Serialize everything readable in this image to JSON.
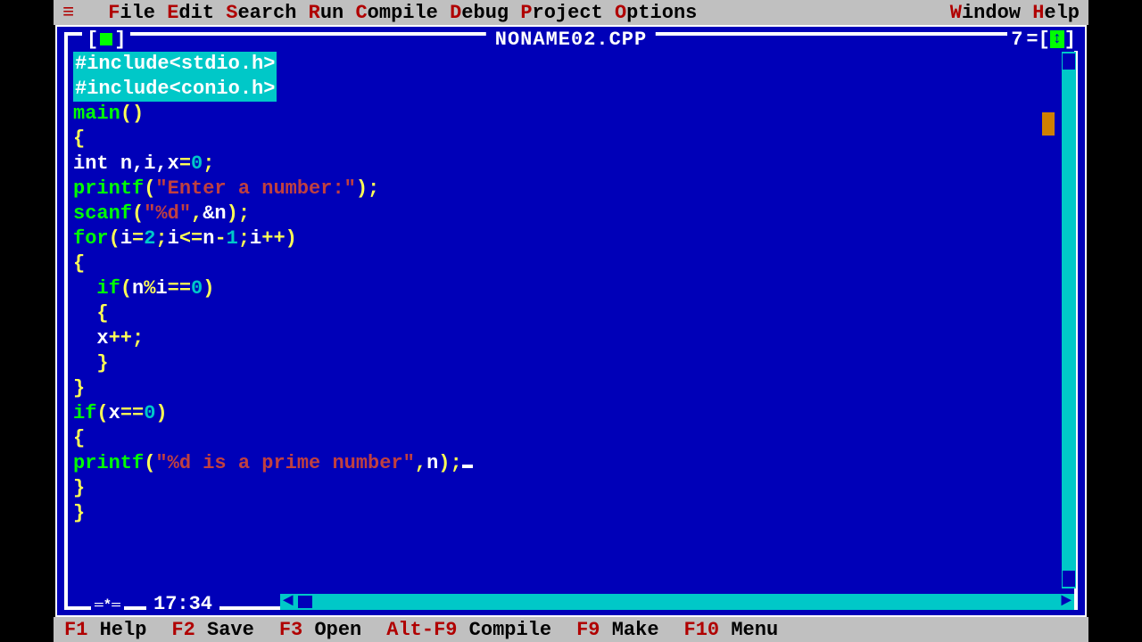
{
  "menu": {
    "icon": "≡",
    "items": [
      {
        "hotkey": "F",
        "rest": "ile"
      },
      {
        "hotkey": "E",
        "rest": "dit"
      },
      {
        "hotkey": "S",
        "rest": "earch"
      },
      {
        "hotkey": "R",
        "rest": "un"
      },
      {
        "hotkey": "C",
        "rest": "ompile"
      },
      {
        "hotkey": "D",
        "rest": "ebug"
      },
      {
        "hotkey": "P",
        "rest": "roject"
      },
      {
        "hotkey": "O",
        "rest": "ptions"
      }
    ],
    "rightItems": [
      {
        "hotkey": "W",
        "rest": "indow"
      },
      {
        "hotkey": "H",
        "rest": "elp"
      }
    ]
  },
  "window": {
    "title": "NONAME02.CPP",
    "windowNumber": "7",
    "cursorPos": "17:34"
  },
  "code": {
    "lines": [
      {
        "type": "include",
        "text": "#include<stdio.h>"
      },
      {
        "type": "include",
        "text": "#include<conio.h>"
      },
      {
        "seg": [
          {
            "c": "kw",
            "t": "main"
          },
          {
            "c": "punc",
            "t": "()"
          }
        ]
      },
      {
        "seg": [
          {
            "c": "punc",
            "t": "{"
          }
        ]
      },
      {
        "seg": [
          {
            "c": "ty",
            "t": "int "
          },
          {
            "c": "ty",
            "t": "n,i,x"
          },
          {
            "c": "punc",
            "t": "="
          },
          {
            "c": "num",
            "t": "0"
          },
          {
            "c": "punc",
            "t": ";"
          }
        ]
      },
      {
        "seg": [
          {
            "c": "kw",
            "t": "printf"
          },
          {
            "c": "punc",
            "t": "("
          },
          {
            "c": "str",
            "t": "\"Enter a number:\""
          },
          {
            "c": "punc",
            "t": ");"
          }
        ]
      },
      {
        "seg": [
          {
            "c": "kw",
            "t": "scanf"
          },
          {
            "c": "punc",
            "t": "("
          },
          {
            "c": "str",
            "t": "\"%d\""
          },
          {
            "c": "punc",
            "t": ","
          },
          {
            "c": "ty",
            "t": "&n"
          },
          {
            "c": "punc",
            "t": ");"
          }
        ]
      },
      {
        "seg": [
          {
            "c": "kw",
            "t": "for"
          },
          {
            "c": "punc",
            "t": "("
          },
          {
            "c": "ty",
            "t": "i"
          },
          {
            "c": "punc",
            "t": "="
          },
          {
            "c": "num",
            "t": "2"
          },
          {
            "c": "punc",
            "t": ";"
          },
          {
            "c": "ty",
            "t": "i"
          },
          {
            "c": "punc",
            "t": "<="
          },
          {
            "c": "ty",
            "t": "n"
          },
          {
            "c": "punc",
            "t": "-"
          },
          {
            "c": "num",
            "t": "1"
          },
          {
            "c": "punc",
            "t": ";"
          },
          {
            "c": "ty",
            "t": "i"
          },
          {
            "c": "punc",
            "t": "++)"
          }
        ]
      },
      {
        "seg": [
          {
            "c": "punc",
            "t": "{"
          }
        ]
      },
      {
        "seg": [
          {
            "c": "ty",
            "t": "  "
          },
          {
            "c": "kw",
            "t": "if"
          },
          {
            "c": "punc",
            "t": "("
          },
          {
            "c": "ty",
            "t": "n"
          },
          {
            "c": "punc",
            "t": "%"
          },
          {
            "c": "ty",
            "t": "i"
          },
          {
            "c": "punc",
            "t": "=="
          },
          {
            "c": "num",
            "t": "0"
          },
          {
            "c": "punc",
            "t": ")"
          }
        ]
      },
      {
        "seg": [
          {
            "c": "ty",
            "t": "  "
          },
          {
            "c": "punc",
            "t": "{"
          }
        ]
      },
      {
        "seg": [
          {
            "c": "ty",
            "t": "  x"
          },
          {
            "c": "punc",
            "t": "++;"
          }
        ]
      },
      {
        "seg": [
          {
            "c": "ty",
            "t": "  "
          },
          {
            "c": "punc",
            "t": "}"
          }
        ]
      },
      {
        "seg": [
          {
            "c": "punc",
            "t": "}"
          }
        ]
      },
      {
        "seg": [
          {
            "c": "kw",
            "t": "if"
          },
          {
            "c": "punc",
            "t": "("
          },
          {
            "c": "ty",
            "t": "x"
          },
          {
            "c": "punc",
            "t": "=="
          },
          {
            "c": "num",
            "t": "0"
          },
          {
            "c": "punc",
            "t": ")"
          }
        ]
      },
      {
        "seg": [
          {
            "c": "punc",
            "t": "{"
          }
        ]
      },
      {
        "seg": [
          {
            "c": "kw",
            "t": "printf"
          },
          {
            "c": "punc",
            "t": "("
          },
          {
            "c": "str",
            "t": "\"%d is a prime number\""
          },
          {
            "c": "punc",
            "t": ","
          },
          {
            "c": "ty",
            "t": "n"
          },
          {
            "c": "punc",
            "t": ");"
          }
        ],
        "cursor": true
      },
      {
        "seg": [
          {
            "c": "punc",
            "t": "}"
          }
        ]
      },
      {
        "seg": [
          {
            "c": "punc",
            "t": "}"
          }
        ]
      }
    ]
  },
  "statusbar": {
    "items": [
      {
        "key": "F1",
        "label": "Help"
      },
      {
        "key": "F2",
        "label": "Save"
      },
      {
        "key": "F3",
        "label": "Open"
      },
      {
        "key": "Alt-F9",
        "label": "Compile"
      },
      {
        "key": "F9",
        "label": "Make"
      },
      {
        "key": "F10",
        "label": "Menu"
      }
    ]
  }
}
